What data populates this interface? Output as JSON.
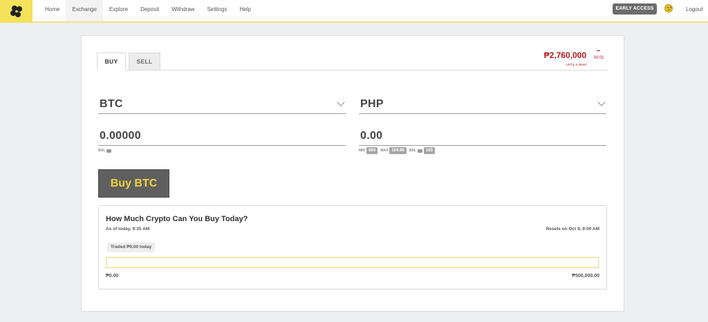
{
  "nav": {
    "items": [
      {
        "label": "Home"
      },
      {
        "label": "Exchange"
      },
      {
        "label": "Explore"
      },
      {
        "label": "Deposit"
      },
      {
        "label": "Withdraw"
      },
      {
        "label": "Settings"
      },
      {
        "label": "Help"
      }
    ],
    "active_index": 1,
    "early_access": "EARLY ACCESS",
    "logout": "Logout"
  },
  "tabs": {
    "buy": "BUY",
    "sell": "SELL"
  },
  "price": {
    "value": "₱2,760,000",
    "until": "UNTIL 8:48AM",
    "countdown": "00:01"
  },
  "buy_form": {
    "crypto_currency": "BTC",
    "crypto_amount": "0.00000",
    "crypto_bal_label": "BAL",
    "fiat_currency": "PHP",
    "fiat_amount": "0.00",
    "min_label": "MIN",
    "min_value": "600",
    "max_label": "MAX",
    "max_value": "104.99",
    "bal_label": "BAL",
    "bal_value": "105",
    "submit_label": "Buy BTC"
  },
  "limit_panel": {
    "title": "How Much Crypto Can You Buy Today?",
    "as_of": "As of today, 9:35 AM",
    "resets": "Resets on Oct 9, 9:00 AM",
    "traded": "Traded ₱0.00 today",
    "progress_fraction": 0,
    "min_amount": "₱0.00",
    "max_amount": "₱500,000.00"
  },
  "colors": {
    "brand_yellow": "#f5e25a",
    "price_red": "#b3191f",
    "button_gray": "#5f5f5f",
    "button_text": "#f0d33b"
  }
}
